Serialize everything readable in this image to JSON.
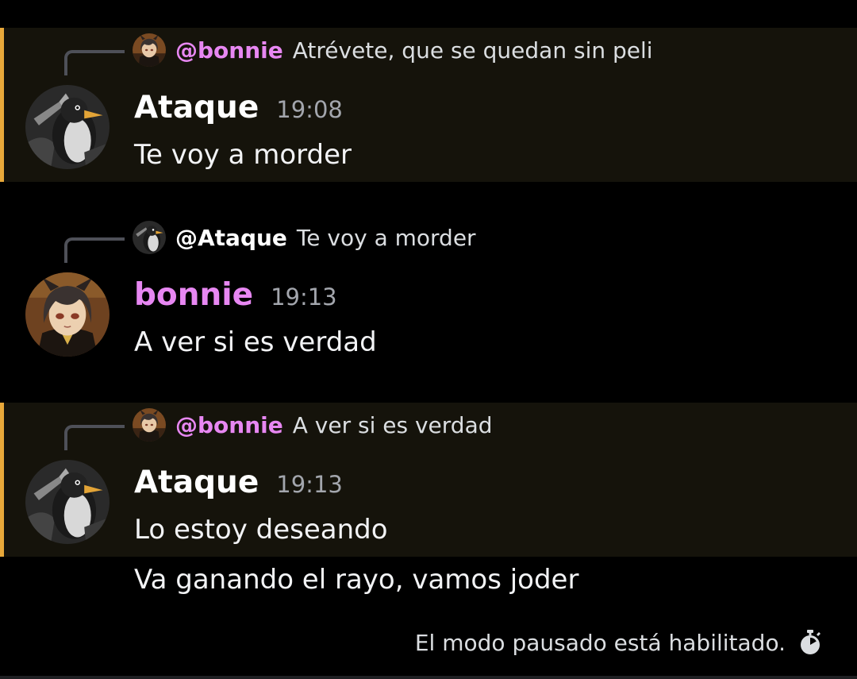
{
  "colors": {
    "mention_bg": "#15130b",
    "mention_bar": "#e8a83a",
    "bonnie_name": "#e787f2",
    "ataque_name": "#ffffff",
    "timestamp": "#a3a6ad"
  },
  "messages": [
    {
      "highlighted": true,
      "reply": {
        "avatar_icon": "bonnie-avatar",
        "author": "@bonnie",
        "text": "Atrévete, que se quedan sin peli"
      },
      "avatar_icon": "ataque-penguin-avatar",
      "author": "Ataque",
      "timestamp": "19:08",
      "text": "Te voy a morder"
    },
    {
      "highlighted": false,
      "reply": {
        "avatar_icon": "ataque-penguin-avatar",
        "author": "@Ataque",
        "text": "Te voy a morder"
      },
      "avatar_icon": "bonnie-avatar",
      "author": "bonnie",
      "timestamp": "19:13",
      "text": "A ver si es verdad"
    },
    {
      "highlighted": true,
      "reply": {
        "avatar_icon": "bonnie-avatar",
        "author": "@bonnie",
        "text": "A ver si es verdad"
      },
      "avatar_icon": "ataque-penguin-avatar",
      "author": "Ataque",
      "timestamp": "19:13",
      "text": "Lo estoy deseando"
    }
  ],
  "continuation": {
    "text": "Va ganando el rayo, vamos joder"
  },
  "footer": {
    "slowmode_text": "El modo pausado está habilitado.",
    "slowmode_icon": "stopwatch-icon"
  }
}
